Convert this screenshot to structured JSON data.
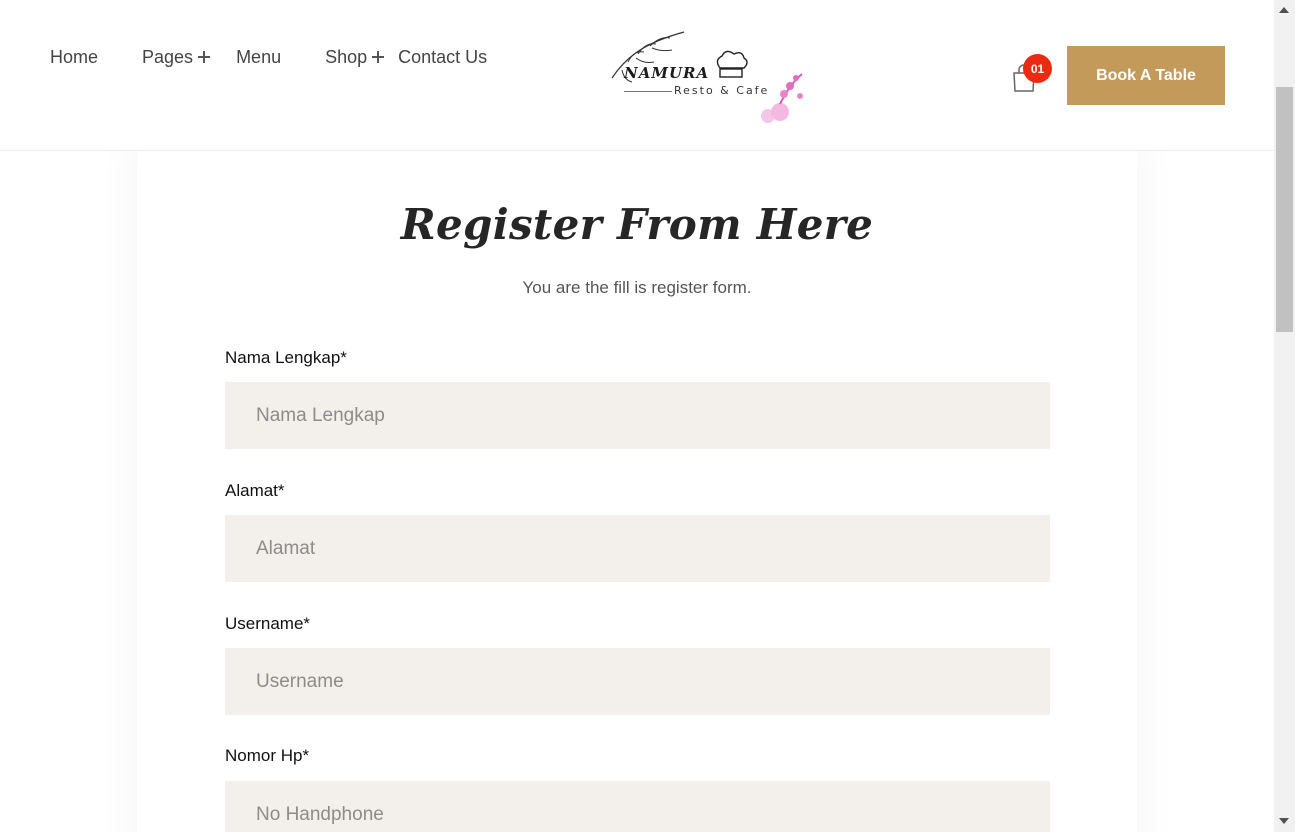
{
  "nav": {
    "home": "Home",
    "pages": "Pages",
    "menu": "Menu",
    "shop": "Shop",
    "contact": "Contact Us"
  },
  "logo": {
    "name": "NAMURA",
    "tagline": "Resto & Cafe"
  },
  "cart": {
    "count": "01",
    "icon": "shopping-bag-icon"
  },
  "header_button": "Book A Table",
  "form": {
    "title": "Register From Here",
    "subtitle": "You are the fill is register form.",
    "fields": [
      {
        "label": "Nama Lengkap*",
        "placeholder": "Nama Lengkap"
      },
      {
        "label": "Alamat*",
        "placeholder": "Alamat"
      },
      {
        "label": "Username*",
        "placeholder": "Username"
      },
      {
        "label": "Nomor Hp*",
        "placeholder": "No Handphone"
      }
    ]
  },
  "colors": {
    "accent": "#c49a5a",
    "badge": "#ea2a12",
    "input_bg": "#f3efeb"
  }
}
